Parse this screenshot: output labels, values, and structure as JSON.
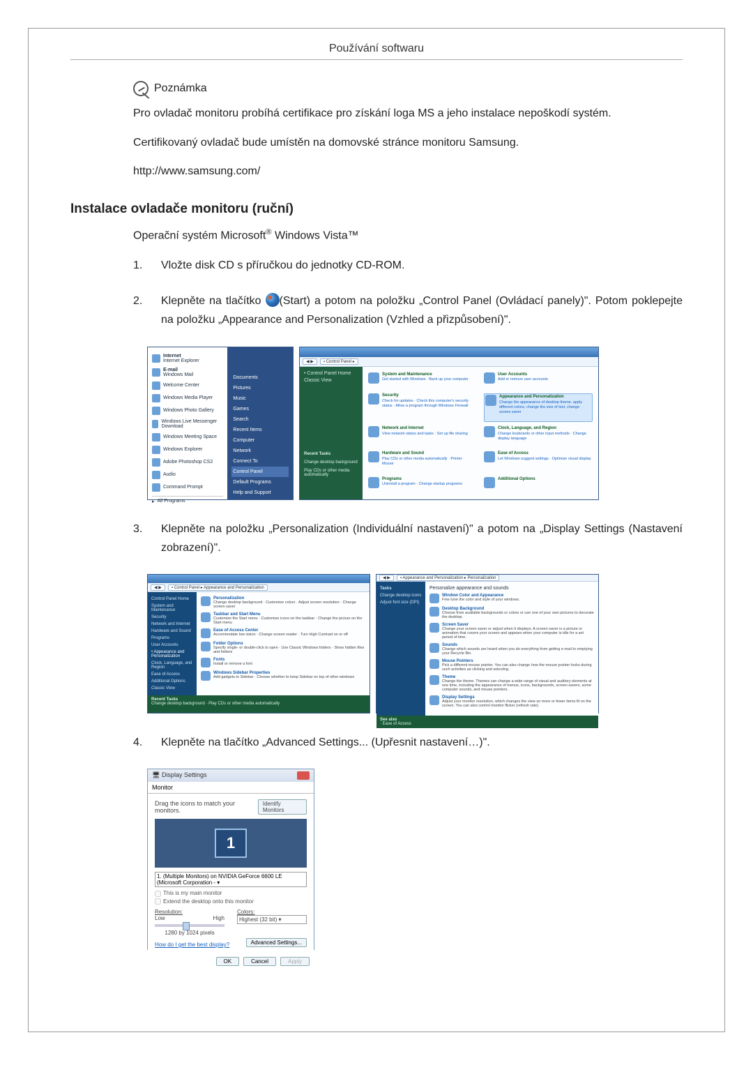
{
  "header": {
    "title": "Používání softwaru"
  },
  "note": {
    "label": "Poznámka",
    "para1": "Pro ovladač monitoru probíhá certifikace pro získání loga MS a jeho instalace nepoškodí systém.",
    "para2": "Certifikovaný ovladač bude umístěn na domovské stránce monitoru Samsung.",
    "url": "http://www.samsung.com/"
  },
  "section": {
    "heading": "Instalace ovladače monitoru (ruční)",
    "os_prefix": "Operační systém Microsoft",
    "os_suffix": " Windows Vista™"
  },
  "steps": {
    "s1": {
      "num": "1.",
      "text": "Vložte disk CD s příručkou do jednotky CD-ROM."
    },
    "s2": {
      "num": "2.",
      "pre": "Klepněte na tlačítko ",
      "post": "(Start) a potom na položku „Control Panel (Ovládací panely)\". Potom poklepejte na položku „Appearance and Personalization (Vzhled a přizpůsobení)\"."
    },
    "s3": {
      "num": "3.",
      "text": "Klepněte na položku „Personalization (Individuální nastavení)\" a potom na „Display Settings (Nastavení zobrazení)\"."
    },
    "s4": {
      "num": "4.",
      "text": "Klepněte na tlačítko „Advanced Settings... (Upřesnit nastavení…)\"."
    }
  },
  "start_menu": {
    "left": {
      "internet": "Internet",
      "internet_sub": "Internet Explorer",
      "email": "E-mail",
      "email_sub": "Windows Mail",
      "welcome": "Welcome Center",
      "wmp": "Windows Media Player",
      "gallery": "Windows Photo Gallery",
      "wlmd": "Windows Live Messenger Download",
      "meeting": "Windows Meeting Space",
      "explorer": "Windows Explorer",
      "ps": "Adobe Photoshop CS2",
      "audio": "Audio",
      "cmd": "Command Prompt",
      "all": "All Programs"
    },
    "right": {
      "docs": "Documents",
      "pics": "Pictures",
      "music": "Music",
      "games": "Games",
      "search": "Search",
      "recent": "Recent Items",
      "computer": "Computer",
      "network": "Network",
      "connect": "Connect To",
      "cp": "Control Panel",
      "defaults": "Default Programs",
      "help": "Help and Support"
    }
  },
  "control_panel": {
    "addr": "Control Panel",
    "side_head": "Control Panel Home",
    "side_classic": "Classic View",
    "recent": "Recent Tasks",
    "recent1": "Change desktop background",
    "recent2": "Play CDs or other media automatically",
    "cats": {
      "sys": "System and Maintenance",
      "sys_sub": "Get started with Windows · Back up your computer",
      "sec": "Security",
      "sec_sub": "Check for updates · Check this computer's security status · Allow a program through Windows Firewall",
      "net": "Network and Internet",
      "net_sub": "View network status and tasks · Set up file sharing",
      "hw": "Hardware and Sound",
      "hw_sub": "Play CDs or other media automatically · Printer · Mouse",
      "prog": "Programs",
      "prog_sub": "Uninstall a program · Change startup programs",
      "user": "User Accounts",
      "user_sub": "Add or remove user accounts",
      "appear": "Appearance and Personalization",
      "appear_sub": "Change the appearance of desktop theme, apply different colors, change the size of text, change screen saver",
      "clock": "Clock, Language, and Region",
      "clock_sub": "Change keyboards or other input methods · Change display language",
      "ease": "Ease of Access",
      "ease_sub": "Let Windows suggest settings · Optimize visual display",
      "add": "Additional Options"
    }
  },
  "personalization": {
    "addr1": "Control Panel ▸ Appearance and Personalization",
    "addr2": "Appearance and Personalization ▸ Personalization",
    "side": {
      "cp_home": "Control Panel Home",
      "sys": "System and Maintenance",
      "sec": "Security",
      "net": "Network and Internet",
      "hw": "Hardware and Sound",
      "prog": "Programs",
      "user": "User Accounts",
      "appear": "Appearance and Personalization",
      "clock": "Clock, Language, and Region",
      "ease": "Ease of Access",
      "add": "Additional Options",
      "classic": "Classic View"
    },
    "left_items": {
      "pers": "Personalization",
      "pers_sub": "Change desktop background · Customize colors · Adjust screen resolution · Change screen saver",
      "task": "Taskbar and Start Menu",
      "task_sub": "Customize the Start menu · Customize icons on the taskbar · Change the picture on the Start menu",
      "ease": "Ease of Access Center",
      "ease_sub": "Accommodate low vision · Change screen reader · Turn High Contrast on or off",
      "folder": "Folder Options",
      "folder_sub": "Specify single- or double-click to open · Use Classic Windows folders · Show hidden files and folders",
      "fonts": "Fonts",
      "fonts_sub": "Install or remove a font",
      "sidebar": "Windows Sidebar Properties",
      "sidebar_sub": "Add gadgets to Sidebar · Choose whether to keep Sidebar on top of other windows"
    },
    "right_head": "Personalize appearance and sounds",
    "right_items": {
      "color": "Window Color and Appearance",
      "color_sub": "Fine tune the color and style of your windows.",
      "bg": "Desktop Background",
      "bg_sub": "Choose from available backgrounds or colors or use one of your own pictures to decorate the desktop.",
      "ss": "Screen Saver",
      "ss_sub": "Change your screen saver or adjust when it displays. A screen saver is a picture or animation that covers your screen and appears when your computer is idle for a set period of time.",
      "sound": "Sounds",
      "sound_sub": "Change which sounds are heard when you do everything from getting e-mail to emptying your Recycle Bin.",
      "mouse": "Mouse Pointers",
      "mouse_sub": "Pick a different mouse pointer. You can also change how the mouse pointer looks during such activities as clicking and selecting.",
      "theme": "Theme",
      "theme_sub": "Change the theme. Themes can change a wide range of visual and auditory elements at one time, including the appearance of menus, icons, backgrounds, screen savers, some computer sounds, and mouse pointers.",
      "disp": "Display Settings",
      "disp_sub": "Adjust your monitor resolution, which changes the view so more or fewer items fit on the screen. You can also control monitor flicker (refresh rate)."
    },
    "tasks": "Tasks",
    "t1": "Change desktop icons",
    "t2": "Adjust font size (DPI)",
    "see": "See also"
  },
  "display_settings": {
    "title": "Display Settings",
    "tab": "Monitor",
    "drag": "Drag the icons to match your monitors.",
    "identify": "Identify Monitors",
    "mon_num": "1",
    "selector": "1. (Multiple Monitors) on NVIDIA GeForce 6600 LE (Microsoft Corporation - ▾",
    "chk1": "This is my main monitor",
    "chk2": "Extend the desktop onto this monitor",
    "res_label": "Resolution:",
    "res_low": "Low",
    "res_high": "High",
    "res_val": "1280 by 1024 pixels",
    "col_label": "Colors:",
    "col_val": "Highest (32 bit)",
    "help": "How do I get the best display?",
    "adv": "Advanced Settings...",
    "ok": "OK",
    "cancel": "Cancel",
    "apply": "Apply"
  }
}
